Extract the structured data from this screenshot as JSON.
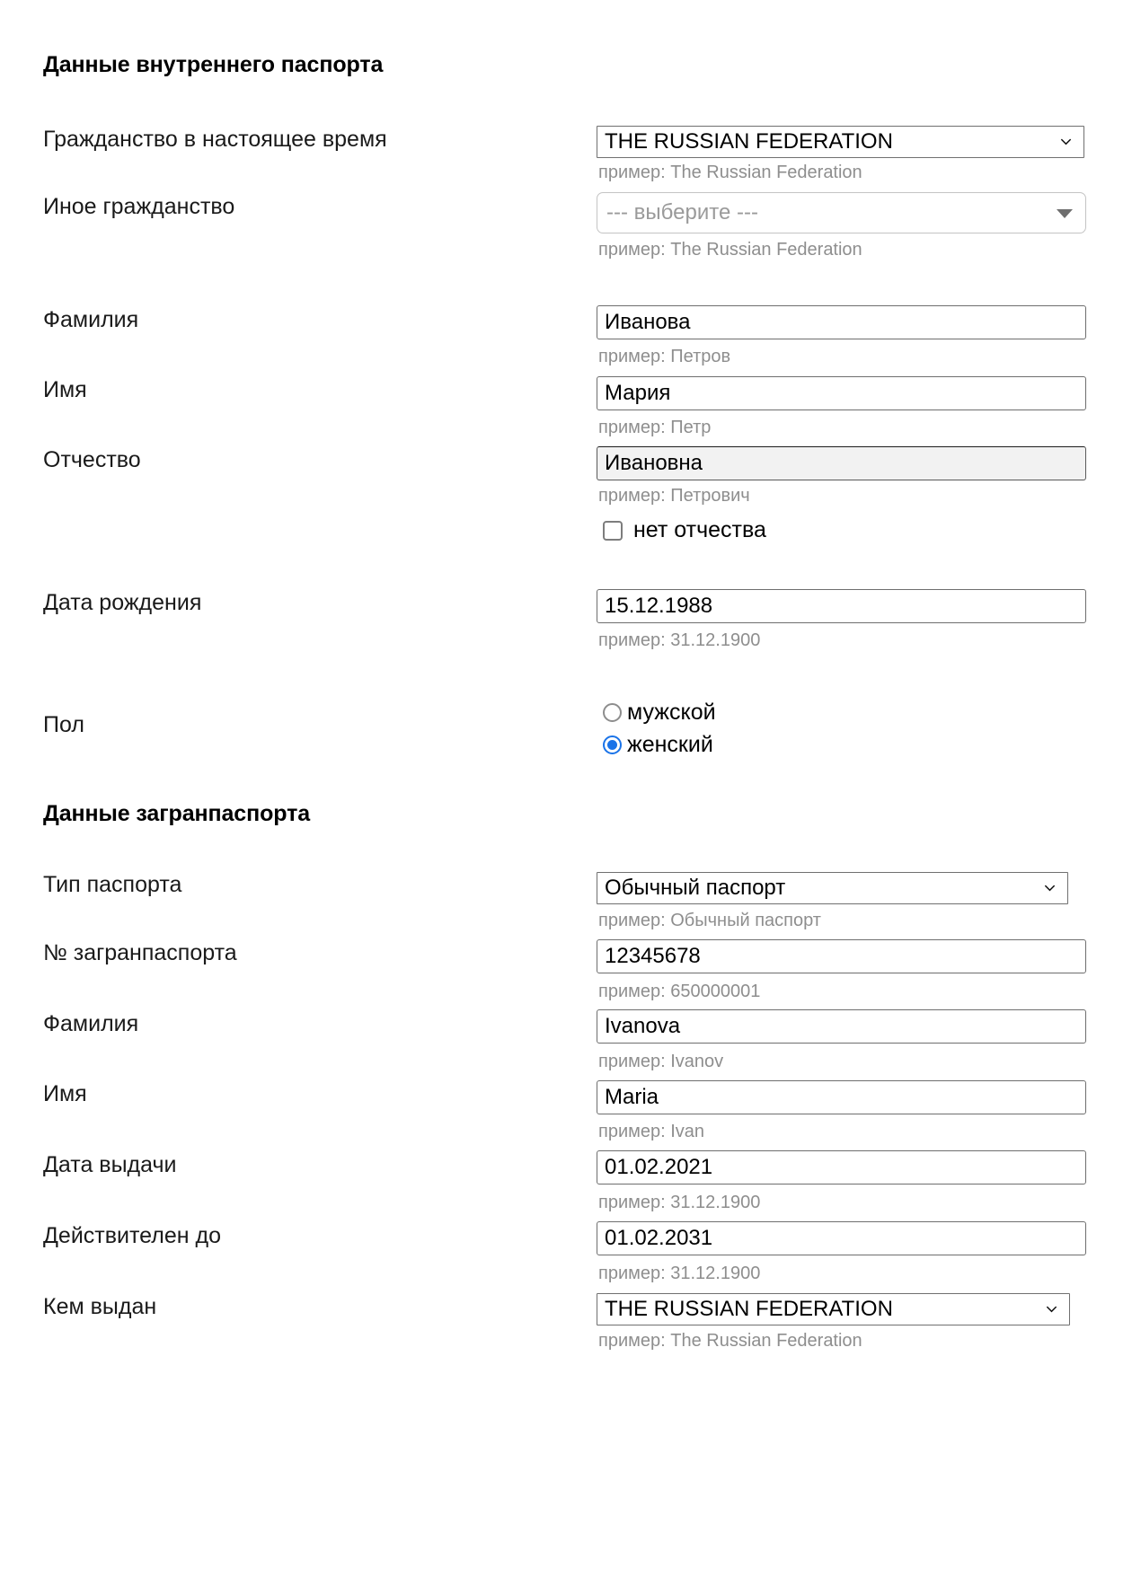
{
  "colors": {
    "accent": "#1a73e8",
    "hint_text": "#8e8e8e",
    "input_border": "#6e6e6e",
    "focused_field_bg": "#f2f2f2"
  },
  "sections": {
    "internal_passport": {
      "heading": "Данные внутреннего паспорта"
    },
    "foreign_passport": {
      "heading": "Данные загранпаспорта"
    }
  },
  "fields": {
    "citizenship_current": {
      "label": "Гражданство в настоящее время",
      "value": "THE RUSSIAN FEDERATION",
      "hint": "пример: The Russian Federation"
    },
    "citizenship_other": {
      "label": "Иное гражданство",
      "placeholder": "--- выберите ---",
      "hint": "пример: The Russian Federation"
    },
    "last_name_ru": {
      "label": "Фамилия",
      "value": "Иванова",
      "hint": "пример: Петров"
    },
    "first_name_ru": {
      "label": "Имя",
      "value": "Мария",
      "hint": "пример: Петр"
    },
    "patronymic_ru": {
      "label": "Отчество",
      "value": "Ивановна",
      "hint": "пример: Петрович"
    },
    "no_patronymic": {
      "label": "нет отчества",
      "checked": false
    },
    "birth_date": {
      "label": "Дата рождения",
      "value": "15.12.1988",
      "hint": "пример: 31.12.1900"
    },
    "sex": {
      "label": "Пол",
      "options": [
        {
          "label": "мужской",
          "selected": false
        },
        {
          "label": "женский",
          "selected": true
        }
      ]
    },
    "passport_type": {
      "label": "Тип паспорта",
      "value": "Обычный паспорт",
      "hint": "пример: Обычный паспорт"
    },
    "passport_number": {
      "label": "№ загранпаспорта",
      "value": "12345678",
      "hint": "пример: 650000001"
    },
    "last_name_lat": {
      "label": "Фамилия",
      "value": "Ivanova",
      "hint": "пример: Ivanov"
    },
    "first_name_lat": {
      "label": "Имя",
      "value": "Maria",
      "hint": "пример: Ivan"
    },
    "issue_date": {
      "label": "Дата выдачи",
      "value": "01.02.2021",
      "hint": "пример: 31.12.1900"
    },
    "valid_until": {
      "label": "Действителен до",
      "value": "01.02.2031",
      "hint": "пример: 31.12.1900"
    },
    "issued_by": {
      "label": "Кем выдан",
      "value": "THE RUSSIAN FEDERATION",
      "hint": "пример: The Russian Federation"
    }
  }
}
